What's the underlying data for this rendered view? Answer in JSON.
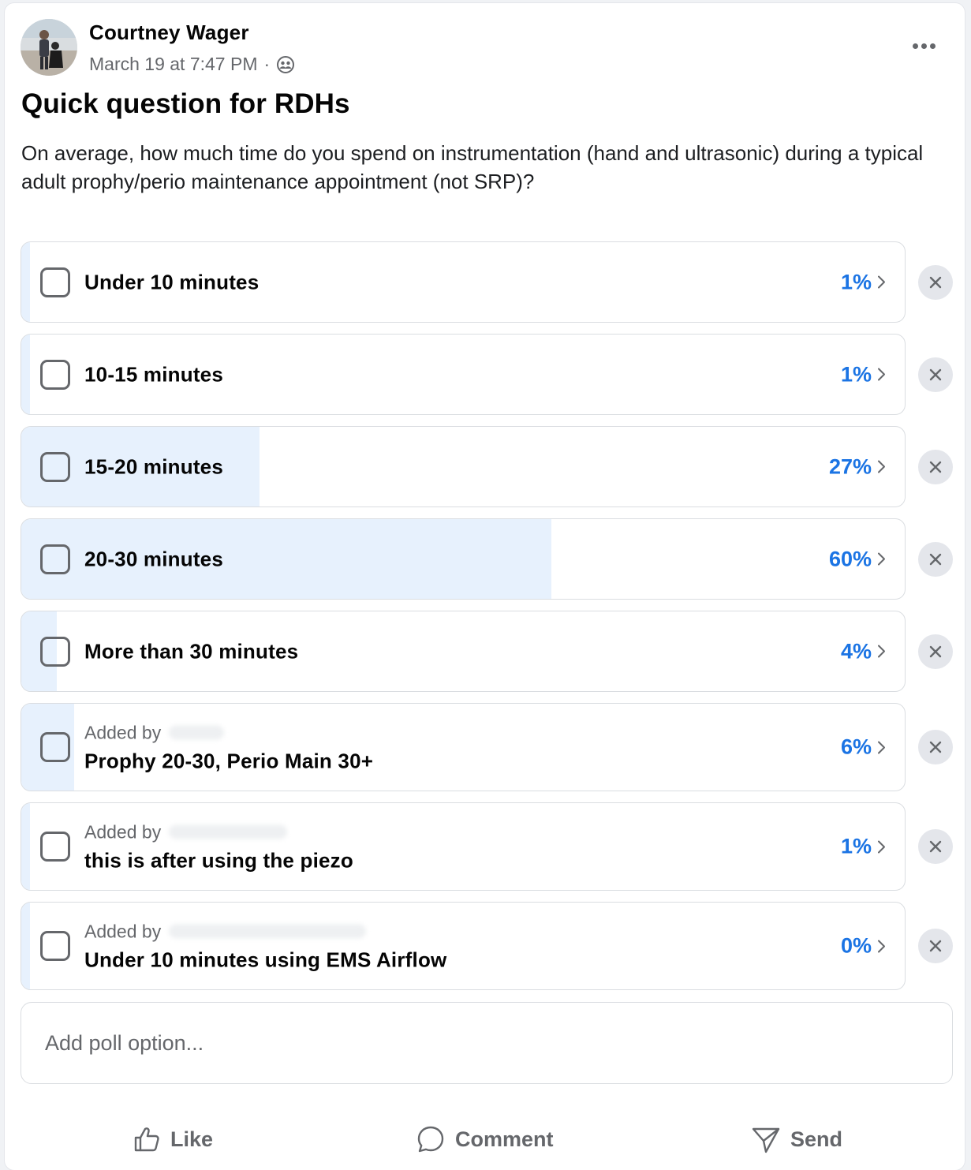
{
  "post": {
    "author": "Courtney Wager",
    "timestamp": "March 19 at 7:47 PM",
    "separator": "·",
    "privacy_icon": "friends-icon",
    "more_icon": "more-options-icon",
    "title": "Quick question for RDHs",
    "body": "On average, how much time do you spend on instrumentation (hand and ultrasonic) during a typical adult prophy/perio maintenance appointment (not SRP)?"
  },
  "poll": {
    "options": [
      {
        "label": "Under 10 minutes",
        "percent": "1%",
        "share": 0.01
      },
      {
        "label": "10-15 minutes",
        "percent": "1%",
        "share": 0.01
      },
      {
        "label": "15-20 minutes",
        "percent": "27%",
        "share": 0.27
      },
      {
        "label": "20-30 minutes",
        "percent": "60%",
        "share": 0.6
      },
      {
        "label": "More than 30 minutes",
        "percent": "4%",
        "share": 0.04
      },
      {
        "added_by": "Added by",
        "label": "Prophy 20-30, Perio Main 30+",
        "percent": "6%",
        "share": 0.06
      },
      {
        "added_by": "Added by",
        "label": "this is after using the piezo",
        "percent": "1%",
        "share": 0.01
      },
      {
        "added_by": "Added by",
        "label": "Under 10 minutes using EMS Airflow",
        "percent": "0%",
        "share": 0.0
      }
    ],
    "add_option_placeholder": "Add poll option..."
  },
  "actions": {
    "like": "Like",
    "comment": "Comment",
    "send": "Send"
  },
  "colors": {
    "accent": "#1b74e4",
    "bar_fill": "#e7f1fd",
    "muted_text": "#65676b",
    "border": "#dadde1"
  }
}
